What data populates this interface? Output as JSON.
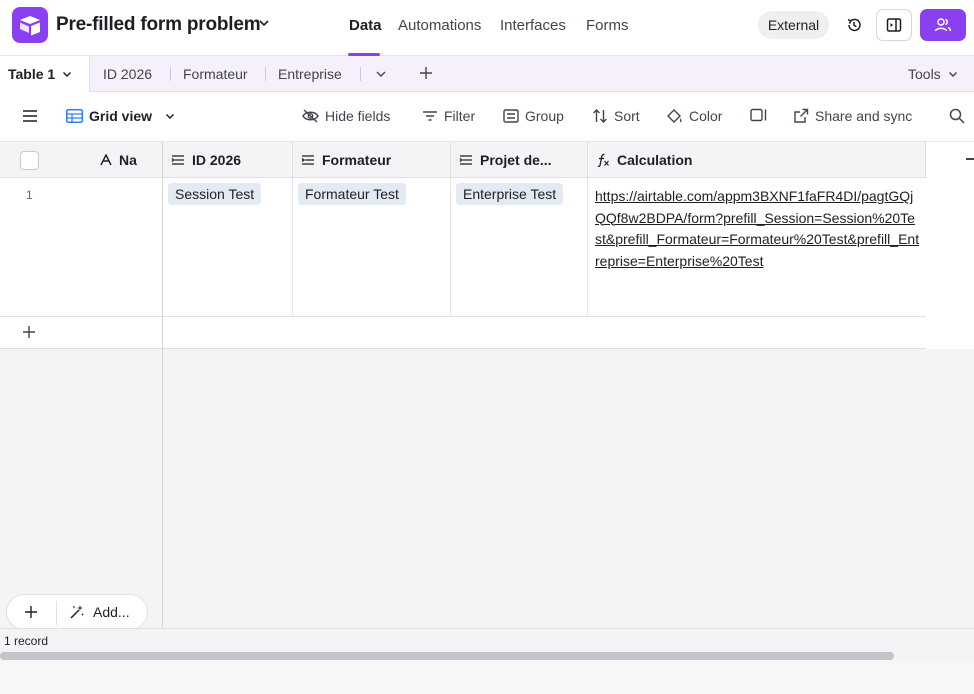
{
  "app": {
    "base_name": "Pre-filled form problem",
    "nav_tabs": [
      {
        "label": "Data",
        "active": true
      },
      {
        "label": "Automations",
        "active": false
      },
      {
        "label": "Interfaces",
        "active": false
      },
      {
        "label": "Forms",
        "active": false
      }
    ],
    "external_label": "External",
    "accent_color": "#8a3ff0"
  },
  "tables": {
    "active": "Table 1",
    "others": [
      "ID 2026",
      "Formateur",
      "Entreprise"
    ],
    "tools_label": "Tools"
  },
  "viewbar": {
    "view_name": "Grid view",
    "hide_fields": "Hide fields",
    "filter": "Filter",
    "group": "Group",
    "sort": "Sort",
    "color": "Color",
    "share_sync": "Share and sync"
  },
  "grid": {
    "columns": [
      {
        "name": "Na",
        "icon": "text-a-icon"
      },
      {
        "name": "ID 2026",
        "icon": "link-field-icon"
      },
      {
        "name": "Formateur",
        "icon": "link-field-icon"
      },
      {
        "name": "Projet de...",
        "icon": "link-field-icon"
      },
      {
        "name": "Calculation",
        "icon": "formula-icon"
      }
    ],
    "rows": [
      {
        "number": "1",
        "name": "",
        "id_2026": "Session Test",
        "formateur": "Formateur Test",
        "projet": "Enterprise Test",
        "calculation": "https://airtable.com/appm3BXNF1faFR4DI/pagtGQjQQf8w2BDPA/form?prefill_Session=Session%20Test&prefill_Formateur=Formateur%20Test&prefill_Entreprise=Enterprise%20Test"
      }
    ]
  },
  "footer": {
    "add_label": "Add...",
    "record_count": "1 record"
  }
}
